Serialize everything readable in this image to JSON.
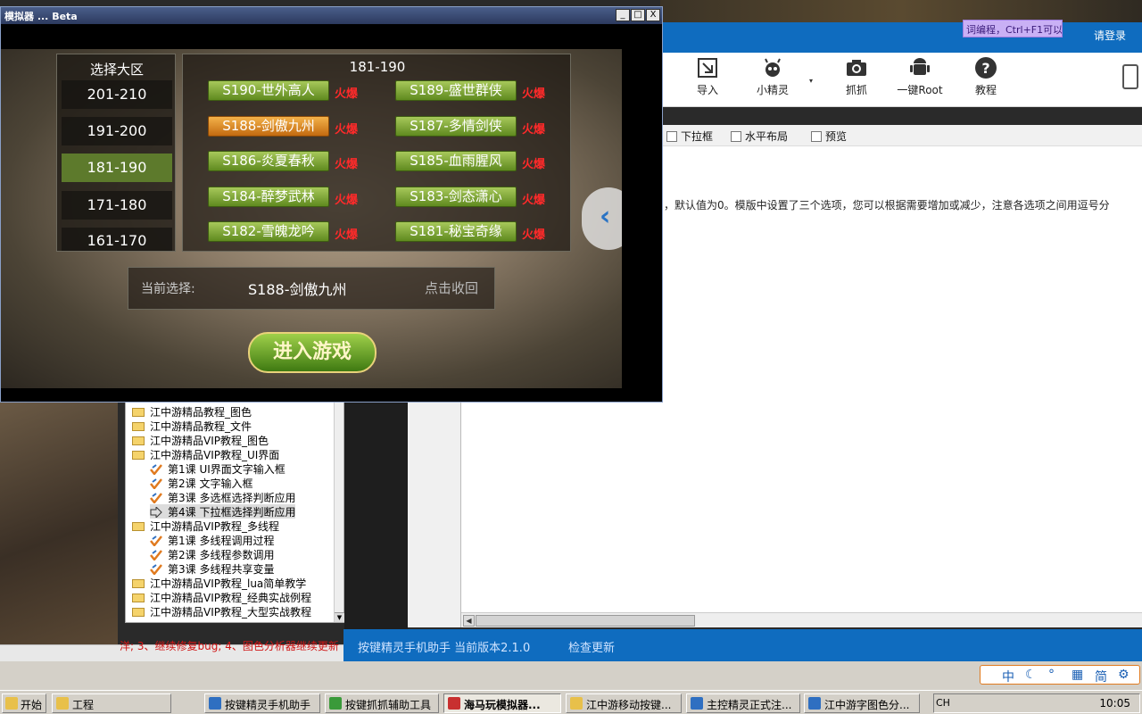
{
  "emulator": {
    "title": "模拟器 ... Beta",
    "minimize": "_",
    "maximize": "□",
    "close": "X"
  },
  "game": {
    "region_title": "选择大区",
    "regions": [
      "201-210",
      "191-200",
      "181-190",
      "171-180",
      "161-170"
    ],
    "active_region_index": 2,
    "server_title": "181-190",
    "servers": [
      {
        "name": "S190-世外高人",
        "tag": "火爆"
      },
      {
        "name": "S189-盛世群侠",
        "tag": "火爆"
      },
      {
        "name": "S188-剑傲九州",
        "tag": "火爆"
      },
      {
        "name": "S187-多情剑侠",
        "tag": "火爆"
      },
      {
        "name": "S186-炎夏春秋",
        "tag": "火爆"
      },
      {
        "name": "S185-血雨腥风",
        "tag": "火爆"
      },
      {
        "name": "S184-醉梦武林",
        "tag": "火爆"
      },
      {
        "name": "S183-剑态潇心",
        "tag": "火爆"
      },
      {
        "name": "S182-雪魄龙吟",
        "tag": "火爆"
      },
      {
        "name": "S181-秘宝奇缘",
        "tag": "火爆"
      }
    ],
    "selected_server_index": 2,
    "current_label": "当前选择:",
    "current_value": "S188-剑傲九州",
    "collapse_label": "点击收回",
    "enter_button": "进入游戏",
    "nav_arrow": "‹"
  },
  "assistant": {
    "login_link": "请登录",
    "hint_bubble": "词编程，Ctrl+F1可以",
    "toolbar": [
      {
        "label": "导入",
        "icon": "import-icon"
      },
      {
        "label": "小精灵",
        "icon": "sprite-icon"
      },
      {
        "label": "抓抓",
        "icon": "camera-icon"
      },
      {
        "label": "一键Root",
        "icon": "android-icon"
      },
      {
        "label": "教程",
        "icon": "help-icon"
      }
    ],
    "toolbar_more": "▾",
    "subbar": [
      "下拉框",
      "水平布局",
      "预览"
    ],
    "doc_text": "，默认值为0。模版中设置了三个选项，您可以根据需要增加或减少，注意各选项之间用逗号分",
    "status_version": "按键精灵手机助手 当前版本2.1.0",
    "status_update": "检查更新"
  },
  "tree": {
    "items": [
      {
        "label": "江中游精品教程_图色",
        "type": "folder",
        "indent": 0
      },
      {
        "label": "江中游精品教程_文件",
        "type": "folder",
        "indent": 0
      },
      {
        "label": "江中游精品VIP教程_图色",
        "type": "folder",
        "indent": 0
      },
      {
        "label": "江中游精品VIP教程_UI界面",
        "type": "folder",
        "indent": 0
      },
      {
        "label": "第1课 UI界面文字输入框",
        "type": "script",
        "indent": 1
      },
      {
        "label": "第2课 文字输入框",
        "type": "script",
        "indent": 1
      },
      {
        "label": "第3课 多选框选择判断应用",
        "type": "script",
        "indent": 1
      },
      {
        "label": "第4课 下拉框选择判断应用",
        "type": "selected",
        "indent": 1
      },
      {
        "label": "江中游精品VIP教程_多线程",
        "type": "folder",
        "indent": 0
      },
      {
        "label": "第1课 多线程调用过程",
        "type": "script",
        "indent": 1
      },
      {
        "label": "第2课 多线程参数调用",
        "type": "script",
        "indent": 1
      },
      {
        "label": "第3课 多线程共享变量",
        "type": "script",
        "indent": 1
      },
      {
        "label": "江中游精品VIP教程_lua简单教学",
        "type": "folder",
        "indent": 0
      },
      {
        "label": "江中游精品VIP教程_经典实战例程",
        "type": "folder",
        "indent": 0
      },
      {
        "label": "江中游精品VIP教程_大型实战教程",
        "type": "folder",
        "indent": 0
      }
    ],
    "log_text": "洋; 3、继续修复bug; 4、图色分析器继续更新"
  },
  "ime": [
    "中",
    "☾",
    "°",
    "▦",
    "简",
    "⚙"
  ],
  "taskbar": {
    "start": "开始",
    "items": [
      {
        "label": "工程",
        "color": "#e8c04a"
      },
      {
        "label": "按键精灵手机助手",
        "color": "#2f6fc1"
      },
      {
        "label": "按键抓抓辅助工具",
        "color": "#3a9a3a"
      },
      {
        "label": "海马玩模拟器...",
        "color": "#c83030",
        "active": true
      },
      {
        "label": "江中游移动按键...",
        "color": "#e8c04a"
      },
      {
        "label": "主控精灵正式注...",
        "color": "#2f6fc1"
      },
      {
        "label": "江中游字图色分...",
        "color": "#2f6fc1"
      }
    ],
    "lang": "CH",
    "clock": "10:05"
  }
}
